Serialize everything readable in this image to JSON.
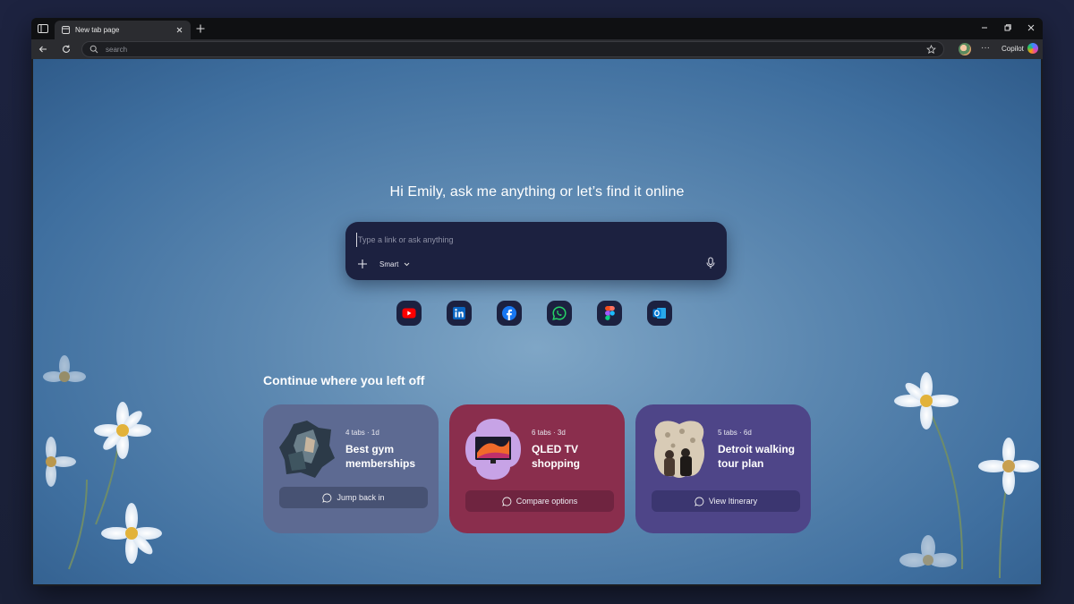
{
  "browser": {
    "tab": {
      "title": "New tab page"
    },
    "address_bar": {
      "placeholder": "search"
    },
    "copilot_label": "Copilot"
  },
  "page": {
    "greeting": "Hi Emily, ask me anything or let’s find it online",
    "search": {
      "placeholder": "Type a link or ask anything",
      "mode_label": "Smart"
    },
    "quick_links": [
      {
        "name": "youtube-icon",
        "color": "#ff0000"
      },
      {
        "name": "linkedin-icon",
        "color": "#0a66c2"
      },
      {
        "name": "facebook-icon",
        "color": "#1877f2"
      },
      {
        "name": "whatsapp-icon",
        "color": "#25d366"
      },
      {
        "name": "figma-icon",
        "color": "#f24e1e"
      },
      {
        "name": "outlook-icon",
        "color": "#0078d4"
      }
    ],
    "continue": {
      "title": "Continue where you left off",
      "cards": [
        {
          "meta": "4 tabs · 1d",
          "title": "Best gym memberships",
          "action": "Jump back in",
          "color": "#5d6a92"
        },
        {
          "meta": "6 tabs · 3d",
          "title": "QLED TV shopping",
          "action": "Compare options",
          "color": "#8a2e4d"
        },
        {
          "meta": "5 tabs · 6d",
          "title": "Detroit walking tour plan",
          "action": "View Itinerary",
          "color": "#4e4588"
        }
      ]
    }
  }
}
